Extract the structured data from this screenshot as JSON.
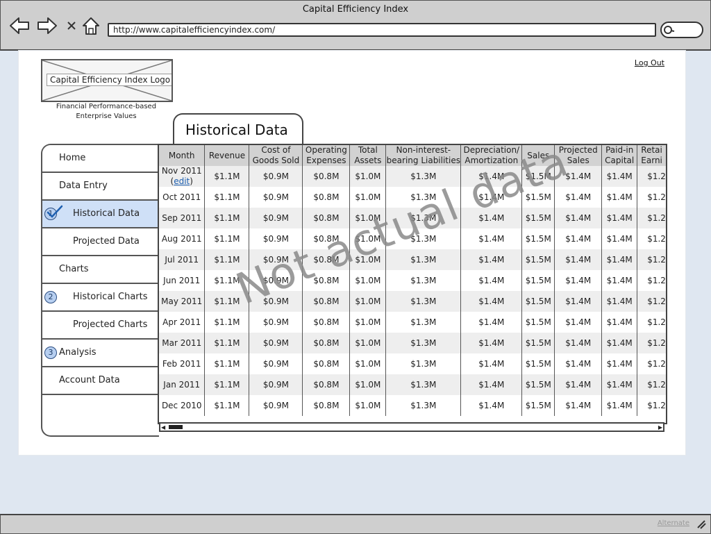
{
  "window": {
    "title": "Capital Efficiency Index",
    "url": "http://www.capitalefficiencyindex.com/"
  },
  "header": {
    "logo_text": "Capital Efficiency Index Logo",
    "tagline_line1": "Financial Performance-based",
    "tagline_line2": "Enterprise Values",
    "logout_label": "Log Out"
  },
  "page_title": "Historical Data",
  "sidebar": {
    "items": [
      {
        "label": "Home",
        "badge": ""
      },
      {
        "label": "Data Entry",
        "badge": ""
      },
      {
        "label": "Historical Data",
        "badge": "1",
        "active": true
      },
      {
        "label": "Projected Data",
        "badge": ""
      },
      {
        "label": "Charts",
        "badge": ""
      },
      {
        "label": "Historical Charts",
        "badge": "2"
      },
      {
        "label": "Projected Charts",
        "badge": ""
      },
      {
        "label": "Analysis",
        "badge": "3"
      },
      {
        "label": "Account Data",
        "badge": ""
      }
    ]
  },
  "table": {
    "columns": [
      {
        "line1": "Month",
        "line2": ""
      },
      {
        "line1": "Revenue",
        "line2": ""
      },
      {
        "line1": "Cost of",
        "line2": "Goods Sold"
      },
      {
        "line1": "Operating",
        "line2": "Expenses"
      },
      {
        "line1": "Total",
        "line2": "Assets"
      },
      {
        "line1": "Non-interest-",
        "line2": "bearing Liabilities"
      },
      {
        "line1": "Depreciation/",
        "line2": "Amortization"
      },
      {
        "line1": "Sales",
        "line2": ""
      },
      {
        "line1": "Projected",
        "line2": "Sales"
      },
      {
        "line1": "Paid-in",
        "line2": "Capital"
      },
      {
        "line1": "Retai",
        "line2": "Earni"
      }
    ],
    "edit_label": "edit",
    "rows": [
      {
        "month": "Nov 2011",
        "values": [
          "$1.1M",
          "$0.9M",
          "$0.8M",
          "$1.0M",
          "$1.3M",
          "$1.4M",
          "$1.5M",
          "$1.4M",
          "$1.4M",
          "$1.2"
        ],
        "editable": true
      },
      {
        "month": "Oct 2011",
        "values": [
          "$1.1M",
          "$0.9M",
          "$0.8M",
          "$1.0M",
          "$1.3M",
          "$1.4M",
          "$1.5M",
          "$1.4M",
          "$1.4M",
          "$1.2"
        ]
      },
      {
        "month": "Sep 2011",
        "values": [
          "$1.1M",
          "$0.9M",
          "$0.8M",
          "$1.0M",
          "$1.3M",
          "$1.4M",
          "$1.5M",
          "$1.4M",
          "$1.4M",
          "$1.2"
        ]
      },
      {
        "month": "Aug 2011",
        "values": [
          "$1.1M",
          "$0.9M",
          "$0.8M",
          "$1.0M",
          "$1.3M",
          "$1.4M",
          "$1.5M",
          "$1.4M",
          "$1.4M",
          "$1.2"
        ]
      },
      {
        "month": "Jul 2011",
        "values": [
          "$1.1M",
          "$0.9M",
          "$0.8M",
          "$1.0M",
          "$1.3M",
          "$1.4M",
          "$1.5M",
          "$1.4M",
          "$1.4M",
          "$1.2"
        ]
      },
      {
        "month": "Jun 2011",
        "values": [
          "$1.1M",
          "$0.9M",
          "$0.8M",
          "$1.0M",
          "$1.3M",
          "$1.4M",
          "$1.5M",
          "$1.4M",
          "$1.4M",
          "$1.2"
        ]
      },
      {
        "month": "May 2011",
        "values": [
          "$1.1M",
          "$0.9M",
          "$0.8M",
          "$1.0M",
          "$1.3M",
          "$1.4M",
          "$1.5M",
          "$1.4M",
          "$1.4M",
          "$1.2"
        ]
      },
      {
        "month": "Apr 2011",
        "values": [
          "$1.1M",
          "$0.9M",
          "$0.8M",
          "$1.0M",
          "$1.3M",
          "$1.4M",
          "$1.5M",
          "$1.4M",
          "$1.4M",
          "$1.2"
        ]
      },
      {
        "month": "Mar 2011",
        "values": [
          "$1.1M",
          "$0.9M",
          "$0.8M",
          "$1.0M",
          "$1.3M",
          "$1.4M",
          "$1.5M",
          "$1.4M",
          "$1.4M",
          "$1.2"
        ]
      },
      {
        "month": "Feb 2011",
        "values": [
          "$1.1M",
          "$0.9M",
          "$0.8M",
          "$1.0M",
          "$1.3M",
          "$1.4M",
          "$1.5M",
          "$1.4M",
          "$1.4M",
          "$1.2"
        ]
      },
      {
        "month": "Jan 2011",
        "values": [
          "$1.1M",
          "$0.9M",
          "$0.8M",
          "$1.0M",
          "$1.3M",
          "$1.4M",
          "$1.5M",
          "$1.4M",
          "$1.4M",
          "$1.2"
        ]
      },
      {
        "month": "Dec 2010",
        "values": [
          "$1.1M",
          "$0.9M",
          "$0.8M",
          "$1.0M",
          "$1.3M",
          "$1.4M",
          "$1.5M",
          "$1.4M",
          "$1.4M",
          "$1.2"
        ]
      }
    ]
  },
  "watermark": "Not actual data",
  "footer": {
    "alternate_label": "Alternate"
  },
  "colors": {
    "active_nav": "#cfe0f7",
    "badge": "#b7cff0",
    "header_row": "#d2d2d2",
    "zebra_row": "#eeeeee",
    "link": "#1d5fb0"
  },
  "icons": [
    "back-arrow-icon",
    "forward-arrow-icon",
    "close-icon",
    "home-icon",
    "search-icon",
    "checkmark-icon",
    "resize-grip-icon"
  ]
}
